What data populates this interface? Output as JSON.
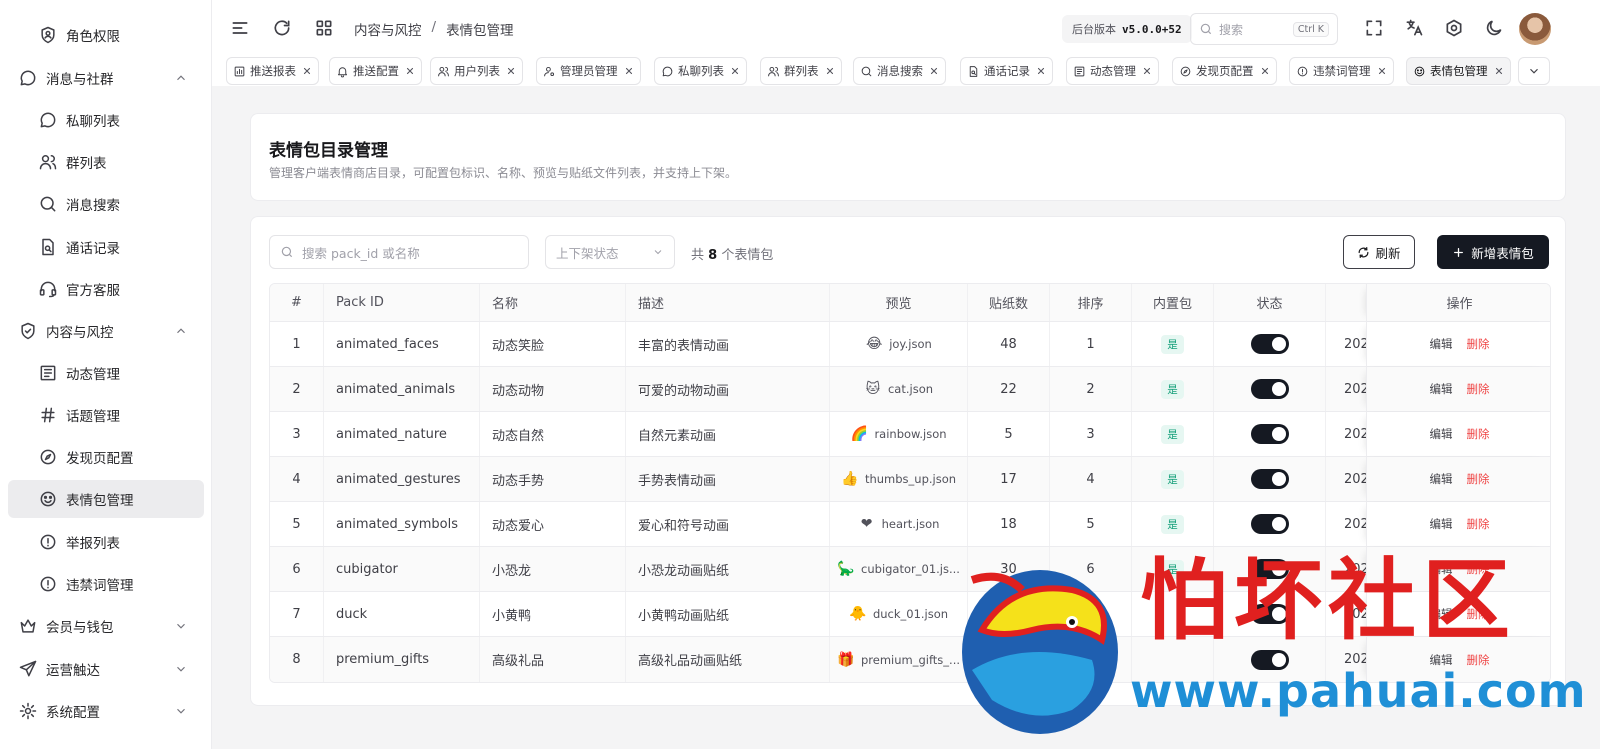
{
  "sidebar": {
    "items": [
      {
        "label": "角色权限",
        "icon": "shield-user-icon",
        "level": "sub"
      },
      {
        "label": "消息与社群",
        "icon": "message-circle-icon",
        "level": "top",
        "expanded": true
      },
      {
        "label": "私聊列表",
        "icon": "message-circle-icon",
        "level": "sub"
      },
      {
        "label": "群列表",
        "icon": "users-icon",
        "level": "sub"
      },
      {
        "label": "消息搜索",
        "icon": "search-icon",
        "level": "sub"
      },
      {
        "label": "通话记录",
        "icon": "file-search-icon",
        "level": "sub"
      },
      {
        "label": "官方客服",
        "icon": "headset-icon",
        "level": "sub"
      },
      {
        "label": "内容与风控",
        "icon": "shield-check-icon",
        "level": "top",
        "expanded": true
      },
      {
        "label": "动态管理",
        "icon": "newspaper-icon",
        "level": "sub"
      },
      {
        "label": "话题管理",
        "icon": "hash-icon",
        "level": "sub"
      },
      {
        "label": "发现页配置",
        "icon": "compass-icon",
        "level": "sub"
      },
      {
        "label": "表情包管理",
        "icon": "smile-icon",
        "level": "sub",
        "active": true
      },
      {
        "label": "举报列表",
        "icon": "alert-circle-icon",
        "level": "sub"
      },
      {
        "label": "违禁词管理",
        "icon": "alert-circle-icon",
        "level": "sub"
      },
      {
        "label": "会员与钱包",
        "icon": "crown-icon",
        "level": "top",
        "expanded": false
      },
      {
        "label": "运营触达",
        "icon": "send-icon",
        "level": "top",
        "expanded": false
      },
      {
        "label": "系统配置",
        "icon": "settings-icon",
        "level": "top",
        "expanded": false
      }
    ]
  },
  "header": {
    "breadcrumb": [
      "内容与风控",
      "表情包管理"
    ],
    "breadcrumb_sep": "/",
    "version_label": "后台版本",
    "version_value": "v5.0.0+52",
    "search_placeholder": "搜索",
    "search_kbd": "Ctrl K"
  },
  "tabs": [
    {
      "label": "推送报表",
      "icon": "bar-chart-icon"
    },
    {
      "label": "推送配置",
      "icon": "bell-icon"
    },
    {
      "label": "用户列表",
      "icon": "users-icon"
    },
    {
      "label": "管理员管理",
      "icon": "user-cog-icon"
    },
    {
      "label": "私聊列表",
      "icon": "message-circle-icon"
    },
    {
      "label": "群列表",
      "icon": "users-icon"
    },
    {
      "label": "消息搜索",
      "icon": "search-icon"
    },
    {
      "label": "通话记录",
      "icon": "file-search-icon"
    },
    {
      "label": "动态管理",
      "icon": "newspaper-icon"
    },
    {
      "label": "发现页配置",
      "icon": "compass-icon"
    },
    {
      "label": "违禁词管理",
      "icon": "alert-circle-icon"
    },
    {
      "label": "表情包管理",
      "icon": "smile-icon",
      "active": true
    }
  ],
  "page": {
    "title": "表情包目录管理",
    "subtitle": "管理客户端表情商店目录，可配置包标识、名称、预览与贴纸文件列表，并支持上下架。"
  },
  "toolbar": {
    "search_placeholder": "搜索 pack_id 或名称",
    "status_placeholder": "上下架状态",
    "count_prefix": "共",
    "count_value": "8",
    "count_suffix": "个表情包",
    "refresh_label": "刷新",
    "add_label": "新增表情包"
  },
  "table": {
    "columns": [
      "#",
      "Pack ID",
      "名称",
      "描述",
      "预览",
      "贴纸数",
      "排序",
      "内置包",
      "状态",
      "",
      "操作"
    ],
    "rows": [
      {
        "num": "1",
        "pack_id": "animated_faces",
        "name": "动态笑脸",
        "desc": "丰富的表情动画",
        "preview_emoji": "😂",
        "preview": "joy.json",
        "count": "48",
        "sort": "1",
        "builtin": "是",
        "enabled": true,
        "date": "202"
      },
      {
        "num": "2",
        "pack_id": "animated_animals",
        "name": "动态动物",
        "desc": "可爱的动物动画",
        "preview_emoji": "🐱",
        "preview": "cat.json",
        "count": "22",
        "sort": "2",
        "builtin": "是",
        "enabled": true,
        "date": "202"
      },
      {
        "num": "3",
        "pack_id": "animated_nature",
        "name": "动态自然",
        "desc": "自然元素动画",
        "preview_emoji": "🌈",
        "preview": "rainbow.json",
        "count": "5",
        "sort": "3",
        "builtin": "是",
        "enabled": true,
        "date": "202"
      },
      {
        "num": "4",
        "pack_id": "animated_gestures",
        "name": "动态手势",
        "desc": "手势表情动画",
        "preview_emoji": "👍",
        "preview": "thumbs_up.json",
        "count": "17",
        "sort": "4",
        "builtin": "是",
        "enabled": true,
        "date": "202"
      },
      {
        "num": "5",
        "pack_id": "animated_symbols",
        "name": "动态爱心",
        "desc": "爱心和符号动画",
        "preview_emoji": "❤",
        "preview": "heart.json",
        "count": "18",
        "sort": "5",
        "builtin": "是",
        "enabled": true,
        "date": "202"
      },
      {
        "num": "6",
        "pack_id": "cubigator",
        "name": "小恐龙",
        "desc": "小恐龙动画贴纸",
        "preview_emoji": "🦕",
        "preview": "cubigator_01.js...",
        "count": "30",
        "sort": "6",
        "builtin": "是",
        "enabled": true,
        "date": "202"
      },
      {
        "num": "7",
        "pack_id": "duck",
        "name": "小黄鸭",
        "desc": "小黄鸭动画贴纸",
        "preview_emoji": "🐥",
        "preview": "duck_01.json",
        "count": "",
        "sort": "",
        "builtin": "",
        "enabled": true,
        "date": "202"
      },
      {
        "num": "8",
        "pack_id": "premium_gifts",
        "name": "高级礼品",
        "desc": "高级礼品动画贴纸",
        "preview_emoji": "🎁",
        "preview": "premium_gifts_...",
        "count": "",
        "sort": "",
        "builtin": "",
        "enabled": true,
        "date": "202"
      }
    ],
    "edit_label": "编辑",
    "delete_label": "删除"
  },
  "watermark": {
    "title": "怕坏社区",
    "url": "www.pahuai.com"
  },
  "colors": {
    "primary": "#151922",
    "danger": "#ef4444",
    "badge_bg": "#e6f7f2",
    "badge_text": "#15a07a",
    "watermark_red": "#e0201f",
    "watermark_blue": "#1f8fd6"
  }
}
